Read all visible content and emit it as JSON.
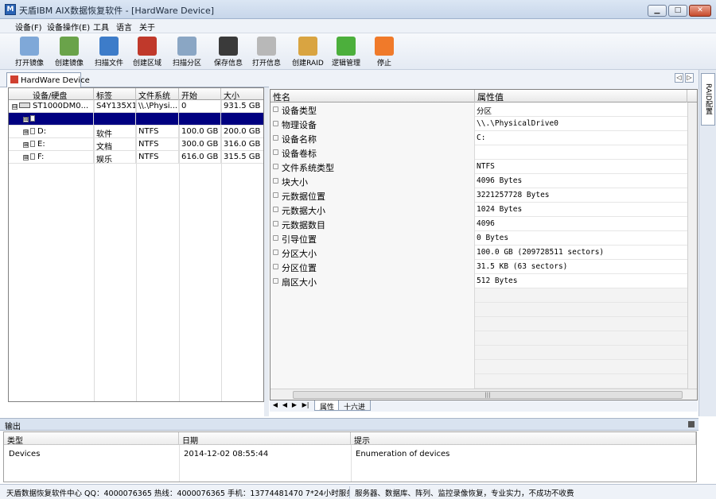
{
  "window": {
    "title": "天盾IBM AIX数据恢复软件 - [HardWare Device]",
    "app_icon_glyph": "M",
    "minimize_glyph": "▁",
    "maximize_glyph": "□",
    "close_glyph": "✕"
  },
  "menu": [
    "设备(F)",
    "设备操作(E)",
    "工具",
    "语言",
    "关于"
  ],
  "toolbar": [
    {
      "label": "打开镜像",
      "icon": "database-open-icon",
      "color": "#7fa8d8"
    },
    {
      "label": "创建镜像",
      "icon": "monitor-icon",
      "color": "#6aa34a"
    },
    {
      "label": "扫描文件",
      "icon": "scan-monitor-icon",
      "color": "#3d7cc9"
    },
    {
      "label": "创建区域",
      "icon": "disk-region-icon",
      "color": "#c0392b"
    },
    {
      "label": "扫描分区",
      "icon": "partition-scan-icon",
      "color": "#8aa6c4"
    },
    {
      "label": "保存信息",
      "icon": "floppy-save-icon",
      "color": "#3a3a3a"
    },
    {
      "label": "打开信息",
      "icon": "printer-open-icon",
      "color": "#b8b8b8"
    },
    {
      "label": "创建RAID",
      "icon": "raid-books-icon",
      "color": "#d9a441"
    },
    {
      "label": "逻辑管理",
      "icon": "gears-icon",
      "color": "#4caf3c"
    },
    {
      "label": "停止",
      "icon": "pause-icon",
      "color": "#f07a2a"
    }
  ],
  "left_panel": {
    "tab_label": "HardWare Device",
    "columns": [
      "设备/硬盘",
      "标签",
      "文件系统",
      "开始",
      "大小"
    ],
    "rows": [
      {
        "tree": "⊟",
        "kind": "disk",
        "name": "ST1000DM0...",
        "label": "S4Y135X1",
        "fs": "\\\\.\\Physi...",
        "start": "0",
        "size": "931.5 GB",
        "selected": false
      },
      {
        "tree": "⊞",
        "kind": "part",
        "name": "",
        "label": "",
        "fs": "",
        "start": "",
        "size": "",
        "selected": true
      },
      {
        "tree": "⊞",
        "kind": "part",
        "name": "D:",
        "label": "软件",
        "fs": "NTFS",
        "start": "100.0 GB",
        "size": "200.0 GB",
        "selected": false
      },
      {
        "tree": "⊞",
        "kind": "part",
        "name": "E:",
        "label": "文档",
        "fs": "NTFS",
        "start": "300.0 GB",
        "size": "316.0 GB",
        "selected": false
      },
      {
        "tree": "⊞",
        "kind": "part",
        "name": "F:",
        "label": "娱乐",
        "fs": "NTFS",
        "start": "616.0 GB",
        "size": "315.5 GB",
        "selected": false
      }
    ]
  },
  "right_panel": {
    "nav_prev": "◁",
    "nav_next": "▷",
    "side_tab": "RAID配置",
    "columns": [
      "性名",
      "属性值"
    ],
    "properties": [
      {
        "name": "设备类型",
        "value": "分区"
      },
      {
        "name": "物理设备",
        "value": "\\\\.\\PhysicalDrive0"
      },
      {
        "name": "设备名称",
        "value": "C:"
      },
      {
        "name": "设备卷标",
        "value": ""
      },
      {
        "name": "文件系统类型",
        "value": "NTFS"
      },
      {
        "name": "块大小",
        "value": "4096 Bytes"
      },
      {
        "name": "元数据位置",
        "value": "3221257728 Bytes"
      },
      {
        "name": "元数据大小",
        "value": "1024 Bytes"
      },
      {
        "name": "元数据数目",
        "value": "4096"
      },
      {
        "name": "引导位置",
        "value": "0 Bytes"
      },
      {
        "name": "分区大小",
        "value": "100.0 GB (209728511 sectors)"
      },
      {
        "name": "分区位置",
        "value": "31.5 KB (63 sectors)"
      },
      {
        "name": "扇区大小",
        "value": "512 Bytes"
      }
    ],
    "scroll_grip": "|||",
    "sheet_nav": [
      "◀",
      "◀",
      "▶",
      "▶|"
    ],
    "sheet_tabs": [
      "属性",
      "十六进"
    ]
  },
  "output": {
    "title": "输出",
    "columns": [
      "类型",
      "日期",
      "提示"
    ],
    "rows": [
      {
        "type": "Devices",
        "date": "2014-12-02 08:55:44",
        "message": "Enumeration of devices"
      }
    ]
  },
  "statusbar": {
    "left": "天盾数据恢复软件中心 QQ：4000076365 热线：4000076365 手机：13774481470  7*24小时服务",
    "right": "服务器、数据库、阵列、监控录像恢复，专业实力，不成功不收费"
  }
}
